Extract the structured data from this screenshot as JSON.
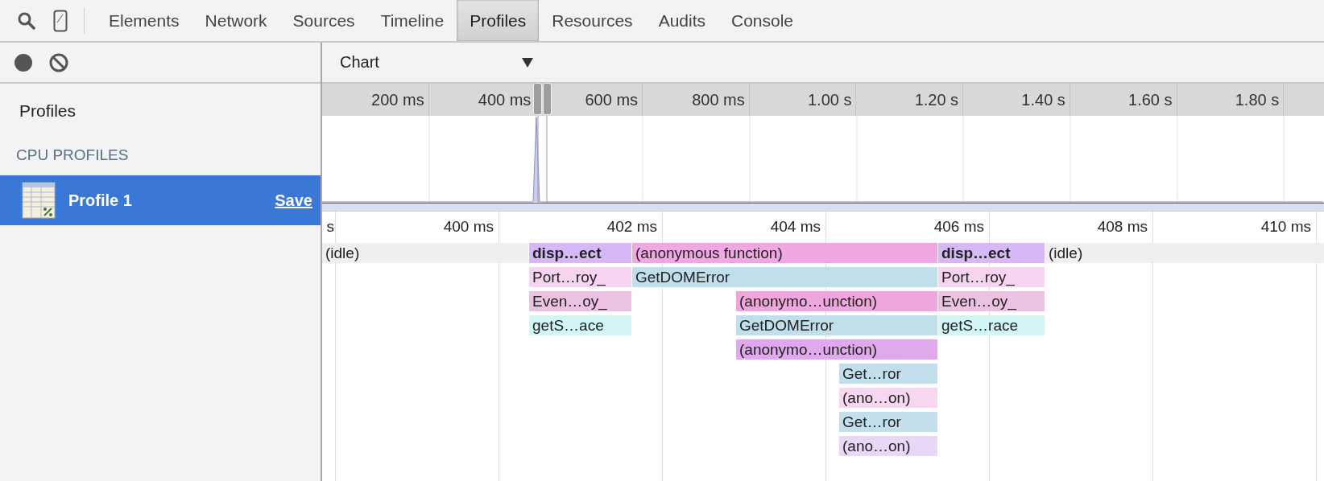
{
  "toolbar": {
    "tabs": [
      {
        "label": "Elements",
        "selected": false
      },
      {
        "label": "Network",
        "selected": false
      },
      {
        "label": "Sources",
        "selected": false
      },
      {
        "label": "Timeline",
        "selected": false
      },
      {
        "label": "Profiles",
        "selected": true
      },
      {
        "label": "Resources",
        "selected": false
      },
      {
        "label": "Audits",
        "selected": false
      },
      {
        "label": "Console",
        "selected": false
      }
    ]
  },
  "sidebar": {
    "title": "Profiles",
    "section": "CPU PROFILES",
    "profiles": [
      {
        "label": "Profile 1",
        "action": "Save",
        "selected": true
      }
    ]
  },
  "view_select": {
    "value": "Chart"
  },
  "overview": {
    "ticks": [
      "200 ms",
      "400 ms",
      "600 ms",
      "800 ms",
      "1.00 s",
      "1.20 s",
      "1.40 s",
      "1.60 s",
      "1.80 s"
    ]
  },
  "flame_chart": {
    "ticks": [
      "s",
      "400 ms",
      "402 ms",
      "404 ms",
      "406 ms",
      "408 ms",
      "410 ms"
    ],
    "rows": [
      {
        "bars": [
          {
            "label": "(idle)",
            "color": "#efefef",
            "kind": "idle"
          },
          {
            "label": "disp…ect",
            "color": "#d5b8f5",
            "kind": "root"
          },
          {
            "label": "(anonymous function)",
            "color": "#f0a8e2",
            "kind": "frame"
          },
          {
            "label": "disp…ect",
            "color": "#d5b8f5",
            "kind": "root"
          },
          {
            "label": "(idle)",
            "color": "#efefef",
            "kind": "idle"
          }
        ]
      },
      {
        "bars": [
          {
            "label": "Port…roy_",
            "color": "#f6d3ee",
            "kind": "frame"
          },
          {
            "label": "GetDOMError",
            "color": "#c1deeb",
            "kind": "frame"
          },
          {
            "label": "Port…roy_",
            "color": "#f6d3ee",
            "kind": "frame"
          }
        ]
      },
      {
        "bars": [
          {
            "label": "Even…oy_",
            "color": "#ecc2e3",
            "kind": "frame"
          },
          {
            "label": "(anonymo…unction)",
            "color": "#eea6dc",
            "kind": "frame"
          },
          {
            "label": "Even…oy_",
            "color": "#ecc2e3",
            "kind": "frame"
          }
        ]
      },
      {
        "bars": [
          {
            "label": "getS…ace",
            "color": "#d2f6f6",
            "kind": "frame"
          },
          {
            "label": "GetDOMError",
            "color": "#c1deeb",
            "kind": "frame"
          },
          {
            "label": "getS…race",
            "color": "#d2f6f6",
            "kind": "frame"
          }
        ]
      },
      {
        "bars": [
          {
            "label": "(anonymo…unction)",
            "color": "#dfa9ec",
            "kind": "frame"
          }
        ]
      },
      {
        "bars": [
          {
            "label": "Get…ror",
            "color": "#c3dfec",
            "kind": "frame"
          }
        ]
      },
      {
        "bars": [
          {
            "label": "(ano…on)",
            "color": "#f7d6ef",
            "kind": "frame"
          }
        ]
      },
      {
        "bars": [
          {
            "label": "Get…ror",
            "color": "#c3dfec",
            "kind": "frame"
          }
        ]
      },
      {
        "bars": [
          {
            "label": "(ano…on)",
            "color": "#e9d7f6",
            "kind": "frame"
          }
        ]
      }
    ]
  }
}
